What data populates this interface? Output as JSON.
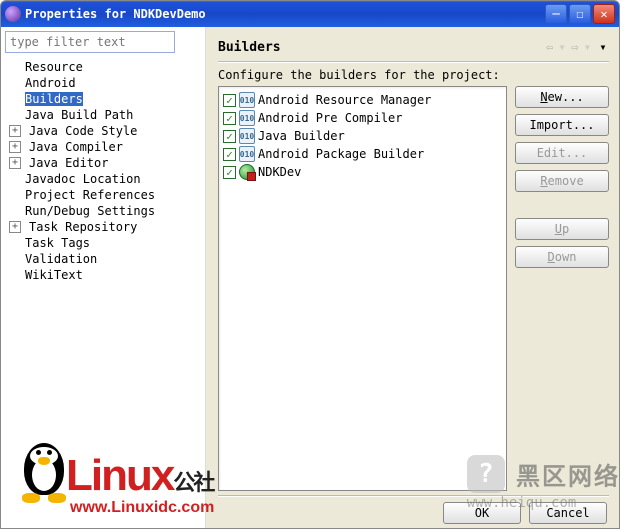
{
  "window": {
    "title": "Properties for NDKDevDemo"
  },
  "filter": {
    "placeholder": "type filter text"
  },
  "tree": {
    "items": [
      {
        "label": "Resource",
        "expandable": false,
        "indent": 1,
        "selected": false
      },
      {
        "label": "Android",
        "expandable": false,
        "indent": 1,
        "selected": false
      },
      {
        "label": "Builders",
        "expandable": false,
        "indent": 1,
        "selected": true
      },
      {
        "label": "Java Build Path",
        "expandable": false,
        "indent": 1,
        "selected": false
      },
      {
        "label": "Java Code Style",
        "expandable": true,
        "indent": 0,
        "selected": false
      },
      {
        "label": "Java Compiler",
        "expandable": true,
        "indent": 0,
        "selected": false
      },
      {
        "label": "Java Editor",
        "expandable": true,
        "indent": 0,
        "selected": false
      },
      {
        "label": "Javadoc Location",
        "expandable": false,
        "indent": 1,
        "selected": false
      },
      {
        "label": "Project References",
        "expandable": false,
        "indent": 1,
        "selected": false
      },
      {
        "label": "Run/Debug Settings",
        "expandable": false,
        "indent": 1,
        "selected": false
      },
      {
        "label": "Task Repository",
        "expandable": true,
        "indent": 0,
        "selected": false
      },
      {
        "label": "Task Tags",
        "expandable": false,
        "indent": 1,
        "selected": false
      },
      {
        "label": "Validation",
        "expandable": false,
        "indent": 1,
        "selected": false
      },
      {
        "label": "WikiText",
        "expandable": false,
        "indent": 1,
        "selected": false
      }
    ]
  },
  "section": {
    "title": "Builders",
    "description": "Configure the builders for the project:"
  },
  "builders": [
    {
      "label": "Android Resource Manager",
      "checked": true,
      "icon": "010"
    },
    {
      "label": "Android Pre Compiler",
      "checked": true,
      "icon": "010"
    },
    {
      "label": "Java Builder",
      "checked": true,
      "icon": "010"
    },
    {
      "label": "Android Package Builder",
      "checked": true,
      "icon": "010"
    },
    {
      "label": "NDKDev",
      "checked": true,
      "icon": "green"
    }
  ],
  "buttons": {
    "new": "New...",
    "import": "Import...",
    "edit": "Edit...",
    "remove": "Remove",
    "up": "Up",
    "down": "Down",
    "ok": "OK",
    "cancel": "Cancel"
  },
  "watermarks": {
    "linux": {
      "brand": "Linux",
      "suffix": "公社",
      "url": "www.Linuxidc.com"
    },
    "heiqu": {
      "brand": "黑区网络",
      "url": "www.heiqu.com",
      "logo": "?"
    }
  }
}
